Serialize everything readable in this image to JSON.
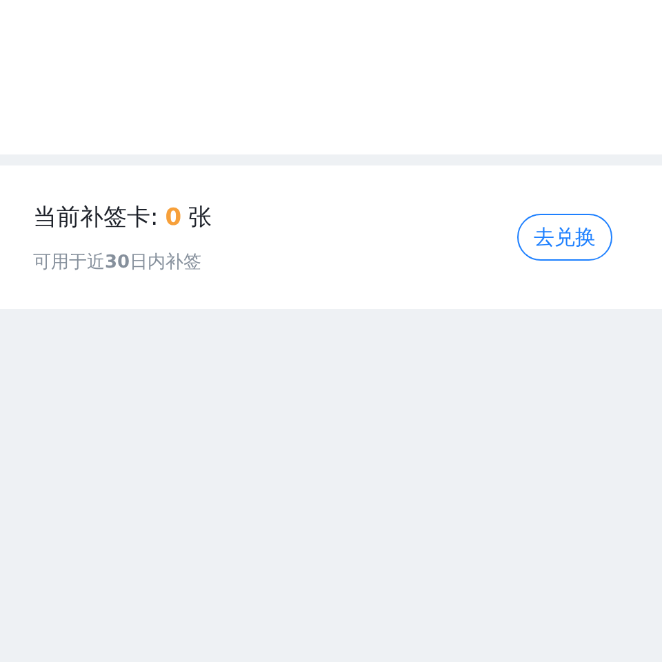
{
  "card": {
    "label": "当前补签卡:",
    "count": "0",
    "unit": "张",
    "note": "可用于近**30**日内补签",
    "button": "去兑换"
  }
}
